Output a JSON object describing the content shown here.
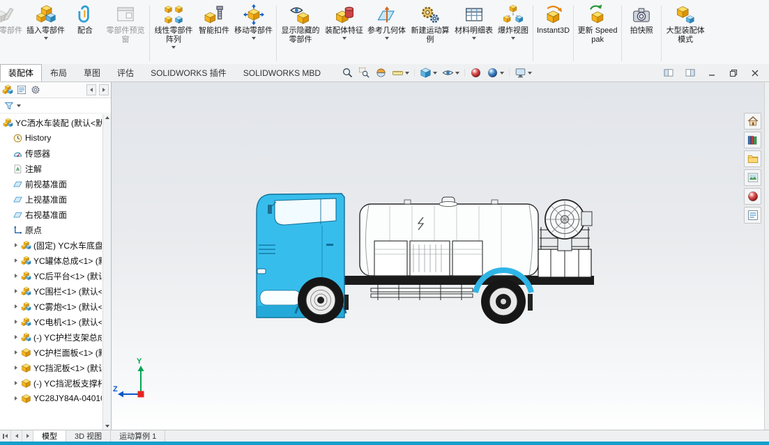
{
  "colors": {
    "status_strip": "#149fca",
    "truck_cab_blue": "#37bdec",
    "viewport_top": "#e2e5ea",
    "triad_y_green": "#00a651",
    "triad_z_blue": "#0a58c8",
    "triad_origin_red": "#e8231f"
  },
  "ribbon": {
    "items": [
      {
        "label": "编辑零部件",
        "enabled": false,
        "dropdown": false
      },
      {
        "label": "插入零部件",
        "enabled": true,
        "dropdown": true
      },
      {
        "label": "配合",
        "enabled": true,
        "dropdown": false
      },
      {
        "label": "零部件预览窗",
        "enabled": false,
        "dropdown": false
      },
      {
        "label": "线性零部件阵列",
        "enabled": true,
        "dropdown": true
      },
      {
        "label": "智能扣件",
        "enabled": true,
        "dropdown": false
      },
      {
        "label": "移动零部件",
        "enabled": true,
        "dropdown": true
      },
      {
        "label": "显示隐藏的零部件",
        "enabled": true,
        "dropdown": false
      },
      {
        "label": "装配体特征",
        "enabled": true,
        "dropdown": true
      },
      {
        "label": "参考几何体",
        "enabled": true,
        "dropdown": true
      },
      {
        "label": "新建运动算例",
        "enabled": true,
        "dropdown": false
      },
      {
        "label": "材料明细表",
        "enabled": true,
        "dropdown": true
      },
      {
        "label": "爆炸视图",
        "enabled": true,
        "dropdown": true
      },
      {
        "label": "Instant3D",
        "enabled": true,
        "dropdown": false
      },
      {
        "label": "更新 Speedpak",
        "enabled": true,
        "dropdown": false
      },
      {
        "label": "拍快照",
        "enabled": true,
        "dropdown": false
      },
      {
        "label": "大型装配体模式",
        "enabled": true,
        "dropdown": false
      }
    ]
  },
  "command_tabs": [
    {
      "label": "装配体",
      "active": true
    },
    {
      "label": "布局",
      "active": false
    },
    {
      "label": "草图",
      "active": false
    },
    {
      "label": "评估",
      "active": false
    },
    {
      "label": "SOLIDWORKS 插件",
      "active": false
    },
    {
      "label": "SOLIDWORKS MBD",
      "active": false
    }
  ],
  "view_toolbar": {
    "icons": [
      "zoom-to-fit",
      "zoom-to-area",
      "section-view",
      "measure",
      "display-style",
      "hide-show-items",
      "edit-appearance",
      "apply-scene",
      "view-settings"
    ]
  },
  "window_controls": [
    "show-left-pane",
    "show-right-pane",
    "minimize",
    "restore",
    "close"
  ],
  "panel_toolbar": {
    "icons": [
      "featuremanager-tree",
      "displaymanager",
      "propertymanager"
    ],
    "arrows": [
      "collapse-pane",
      "expand-pane"
    ]
  },
  "feature_tree": {
    "root": "YC洒水车装配 (默认<默",
    "items": [
      {
        "label": "History",
        "type": "history"
      },
      {
        "label": "传感器",
        "type": "sensors"
      },
      {
        "label": "注解",
        "type": "annotations"
      },
      {
        "label": "前视基准面",
        "type": "plane"
      },
      {
        "label": "上视基准面",
        "type": "plane"
      },
      {
        "label": "右视基准面",
        "type": "plane"
      },
      {
        "label": "原点",
        "type": "origin"
      },
      {
        "label": "(固定) YC水车底盘<",
        "type": "component"
      },
      {
        "label": "YC罐体总成<1> (默",
        "type": "component"
      },
      {
        "label": "YC后平台<1> (默认",
        "type": "component"
      },
      {
        "label": "YC围栏<1> (默认<",
        "type": "component"
      },
      {
        "label": "YC雾炮<1> (默认<",
        "type": "component"
      },
      {
        "label": "YC电机<1> (默认<",
        "type": "component"
      },
      {
        "label": "(-) YC护栏支架总成",
        "type": "component"
      },
      {
        "label": "YC护栏面板<1> (默",
        "type": "component"
      },
      {
        "label": "YC挡泥板<1> (默认",
        "type": "component"
      },
      {
        "label": "(-) YC挡泥板支撑杆",
        "type": "component"
      },
      {
        "label": "YC28JY84A-04010(",
        "type": "component"
      }
    ]
  },
  "task_pane": {
    "icons": [
      "solidworks-resources",
      "design-library",
      "file-explorer",
      "view-palette",
      "appearances-scenes",
      "custom-properties"
    ]
  },
  "bottom_tabs": [
    {
      "label": "模型",
      "active": true
    },
    {
      "label": "3D 视图",
      "active": false
    },
    {
      "label": "运动算例 1",
      "active": false
    }
  ],
  "triad": {
    "y_label": "Y",
    "z_label": "Z"
  }
}
